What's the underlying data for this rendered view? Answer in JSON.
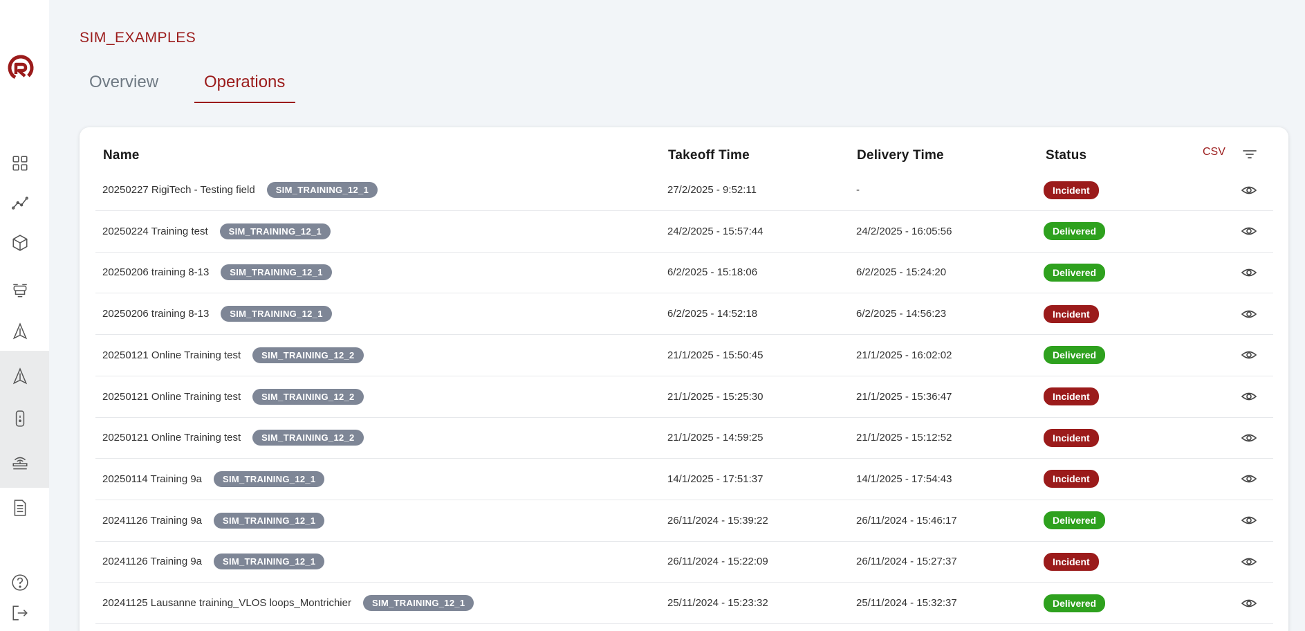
{
  "app": {
    "title": "SIM_EXAMPLES",
    "brand_color": "#9b1b1b"
  },
  "sidebar": {
    "logo": "rigitech-logo",
    "items": [
      {
        "icon": "dashboard-icon"
      },
      {
        "icon": "analytics-icon"
      },
      {
        "icon": "package-icon"
      },
      {
        "icon": "drone-icon"
      },
      {
        "icon": "operations-icon"
      },
      {
        "icon": "operations-sim-icon"
      },
      {
        "icon": "remote-controller-icon"
      },
      {
        "icon": "base-station-icon"
      },
      {
        "icon": "documents-icon"
      }
    ],
    "bottom": [
      {
        "icon": "help-icon"
      },
      {
        "icon": "logout-icon"
      }
    ]
  },
  "tabs": [
    {
      "label": "Overview",
      "active": false
    },
    {
      "label": "Operations",
      "active": true
    }
  ],
  "table": {
    "headers": {
      "name": "Name",
      "takeoff": "Takeoff Time",
      "delivery": "Delivery Time",
      "status": "Status"
    },
    "csv_label": "CSV",
    "rows": [
      {
        "name": "20250227 RigiTech - Testing field",
        "tag": "SIM_TRAINING_12_1",
        "takeoff": "27/2/2025 - 9:52:11",
        "delivery": "-",
        "status": "Incident"
      },
      {
        "name": "20250224 Training test",
        "tag": "SIM_TRAINING_12_1",
        "takeoff": "24/2/2025 - 15:57:44",
        "delivery": "24/2/2025 - 16:05:56",
        "status": "Delivered"
      },
      {
        "name": "20250206 training 8-13",
        "tag": "SIM_TRAINING_12_1",
        "takeoff": "6/2/2025 - 15:18:06",
        "delivery": "6/2/2025 - 15:24:20",
        "status": "Delivered"
      },
      {
        "name": "20250206 training 8-13",
        "tag": "SIM_TRAINING_12_1",
        "takeoff": "6/2/2025 - 14:52:18",
        "delivery": "6/2/2025 - 14:56:23",
        "status": "Incident"
      },
      {
        "name": "20250121 Online Training test",
        "tag": "SIM_TRAINING_12_2",
        "takeoff": "21/1/2025 - 15:50:45",
        "delivery": "21/1/2025 - 16:02:02",
        "status": "Delivered"
      },
      {
        "name": "20250121 Online Training test",
        "tag": "SIM_TRAINING_12_2",
        "takeoff": "21/1/2025 - 15:25:30",
        "delivery": "21/1/2025 - 15:36:47",
        "status": "Incident"
      },
      {
        "name": "20250121 Online Training test",
        "tag": "SIM_TRAINING_12_2",
        "takeoff": "21/1/2025 - 14:59:25",
        "delivery": "21/1/2025 - 15:12:52",
        "status": "Incident"
      },
      {
        "name": "20250114 Training 9a",
        "tag": "SIM_TRAINING_12_1",
        "takeoff": "14/1/2025 - 17:51:37",
        "delivery": "14/1/2025 - 17:54:43",
        "status": "Incident"
      },
      {
        "name": "20241126 Training 9a",
        "tag": "SIM_TRAINING_12_1",
        "takeoff": "26/11/2024 - 15:39:22",
        "delivery": "26/11/2024 - 15:46:17",
        "status": "Delivered"
      },
      {
        "name": "20241126 Training 9a",
        "tag": "SIM_TRAINING_12_1",
        "takeoff": "26/11/2024 - 15:22:09",
        "delivery": "26/11/2024 - 15:27:37",
        "status": "Incident"
      },
      {
        "name": "20241125 Lausanne training_VLOS loops_Montrichier",
        "tag": "SIM_TRAINING_12_1",
        "takeoff": "25/11/2024 - 15:23:32",
        "delivery": "25/11/2024 - 15:32:37",
        "status": "Delivered"
      }
    ]
  },
  "status_colors": {
    "Incident": "#9b1b1b",
    "Delivered": "#2ea11e"
  }
}
